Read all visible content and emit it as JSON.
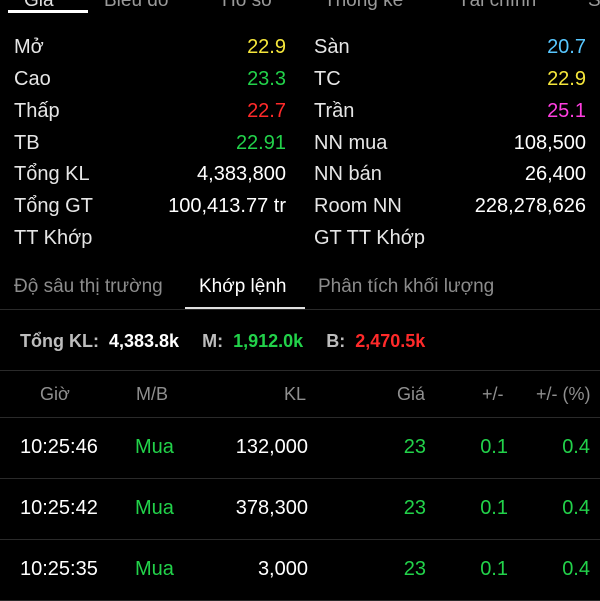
{
  "colors": {
    "yellow": "#f5e63b",
    "green": "#22d24a",
    "red": "#ff2a2a",
    "cyan": "#58c7ff",
    "magenta": "#ff3fe0",
    "white": "#ffffff"
  },
  "top_tabs": [
    "Giá",
    "Biểu đồ",
    "Hồ sơ",
    "Thống kê",
    "Tài chính",
    "S"
  ],
  "stats": {
    "left": [
      {
        "label": "Mở",
        "value": "22.9",
        "color": "#f5e63b"
      },
      {
        "label": "Cao",
        "value": "23.3",
        "color": "#22d24a"
      },
      {
        "label": "Thấp",
        "value": "22.7",
        "color": "#ff2a2a"
      },
      {
        "label": "TB",
        "value": "22.91",
        "color": "#22d24a"
      },
      {
        "label": "Tổng KL",
        "value": "4,383,800",
        "color": "#ffffff"
      },
      {
        "label": "Tổng GT",
        "value": "100,413.77 tr",
        "color": "#ffffff"
      },
      {
        "label": "TT Khớp",
        "value": "",
        "color": "#ffffff"
      }
    ],
    "right": [
      {
        "label": "Sàn",
        "value": "20.7",
        "color": "#58c7ff"
      },
      {
        "label": "TC",
        "value": "22.9",
        "color": "#f5e63b"
      },
      {
        "label": "Trần",
        "value": "25.1",
        "color": "#ff3fe0"
      },
      {
        "label": "NN mua",
        "value": "108,500",
        "color": "#ffffff"
      },
      {
        "label": "NN bán",
        "value": "26,400",
        "color": "#ffffff"
      },
      {
        "label": "Room NN",
        "value": "228,278,626",
        "color": "#ffffff"
      },
      {
        "label": "GT TT Khớp",
        "value": "",
        "color": "#ffffff"
      }
    ]
  },
  "sub_tabs": {
    "depth": "Độ sâu thị trường",
    "matched": "Khớp lệnh",
    "volume_analysis": "Phân tích khối lượng",
    "active": "matched"
  },
  "summary": {
    "total_label": "Tổng KL:",
    "total_value": "4,383.8k",
    "buy_label": "M:",
    "buy_value": "1,912.0k",
    "sell_label": "B:",
    "sell_value": "2,470.5k"
  },
  "table": {
    "headers": {
      "time": "Giờ",
      "side": "M/B",
      "volume": "KL",
      "price": "Giá",
      "change": "+/-",
      "change_pct": "+/- (%)"
    },
    "rows": [
      {
        "time": "10:25:46",
        "side": "Mua",
        "volume": "132,000",
        "price": "23",
        "change": "0.1",
        "change_pct": "0.4"
      },
      {
        "time": "10:25:42",
        "side": "Mua",
        "volume": "378,300",
        "price": "23",
        "change": "0.1",
        "change_pct": "0.4"
      },
      {
        "time": "10:25:35",
        "side": "Mua",
        "volume": "3,000",
        "price": "23",
        "change": "0.1",
        "change_pct": "0.4"
      }
    ]
  }
}
